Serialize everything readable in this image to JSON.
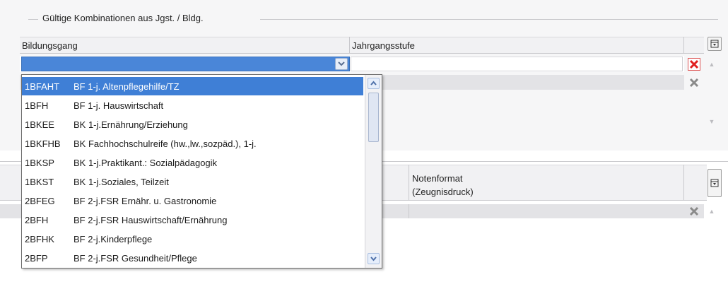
{
  "group": {
    "title": "Gültige Kombinationen aus Jgst. / Bldg."
  },
  "grid": {
    "col_bildungsgang": "Bildungsgang",
    "col_jahrgangsstufe": "Jahrgangsstufe"
  },
  "lower": {
    "col_notenformat_line1": "Notenformat",
    "col_notenformat_line2": "(Zeugnisdruck)"
  },
  "dropdown": {
    "items": [
      {
        "code": "1BFAHT",
        "name": "BF 1-j. Altenpflegehilfe/TZ"
      },
      {
        "code": "1BFH",
        "name": "BF 1-j. Hauswirtschaft"
      },
      {
        "code": "1BKEE",
        "name": "BK 1-j.Ernährung/Erziehung"
      },
      {
        "code": "1BKFHB",
        "name": "BK Fachhochschulreife (hw.,lw.,sozpäd.), 1-j."
      },
      {
        "code": "1BKSP",
        "name": "BK 1-j.Praktikant.: Sozialpädagogik"
      },
      {
        "code": "1BKST",
        "name": "BK 1-j.Soziales, Teilzeit"
      },
      {
        "code": "2BFEG",
        "name": "BF 2-j.FSR Ernähr. u. Gastronomie"
      },
      {
        "code": "2BFH",
        "name": "BF 2-j.FSR Hauswirtschaft/Ernährung"
      },
      {
        "code": "2BFHK",
        "name": "BF 2-j.Kinderpflege"
      },
      {
        "code": "2BFP",
        "name": "BF 2-j.FSR Gesundheit/Pflege"
      }
    ]
  },
  "icons": {
    "combo_arrow": "chevron-down-icon",
    "column_chooser": "column-chooser-icon",
    "delete_active": "delete-x-icon",
    "delete_inactive": "delete-x-icon"
  },
  "colors": {
    "selection": "#3f7fd6",
    "delete_red": "#e02020"
  }
}
